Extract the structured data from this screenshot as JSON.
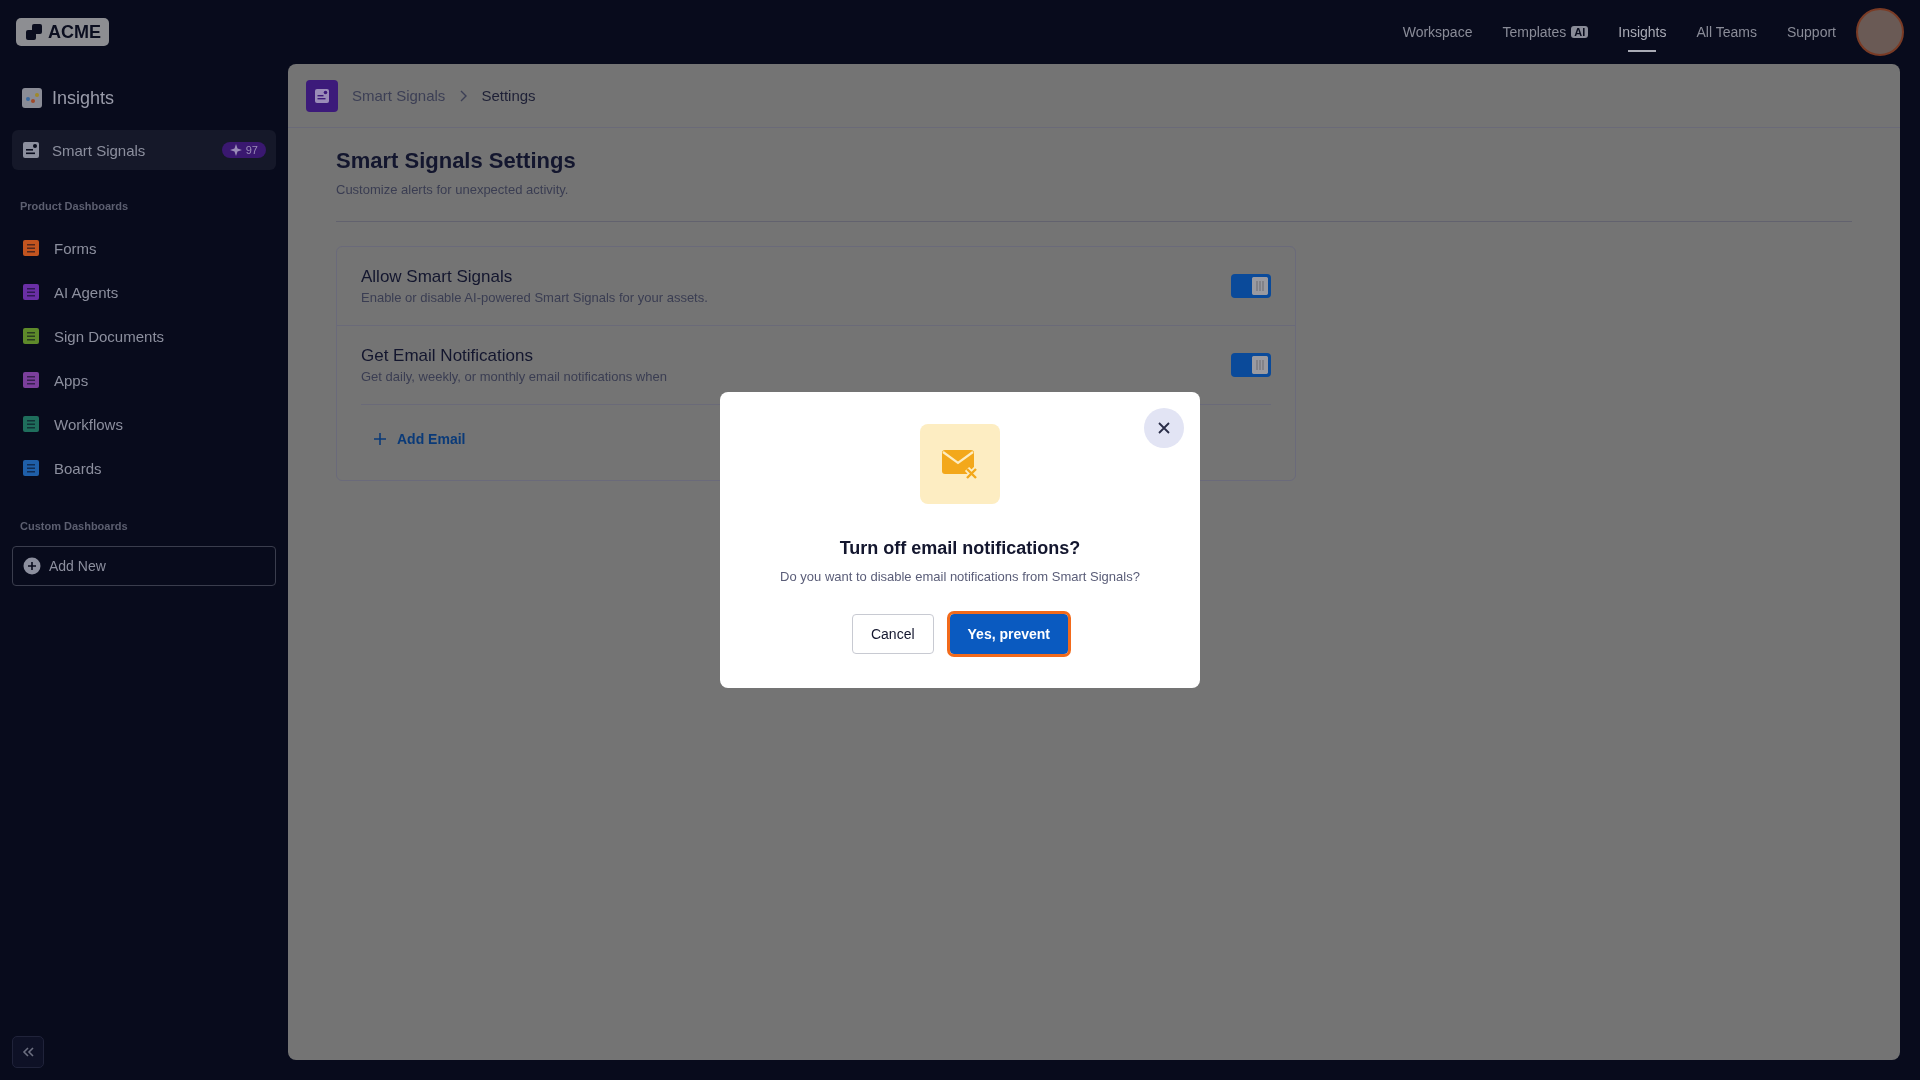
{
  "topbar": {
    "logo": "ACME",
    "nav": [
      {
        "label": "Workspace",
        "selected": false
      },
      {
        "label": "Templates",
        "badge": "AI",
        "selected": false
      },
      {
        "label": "Insights",
        "selected": true
      },
      {
        "label": "All Teams",
        "selected": false
      },
      {
        "label": "Support",
        "selected": false
      }
    ]
  },
  "sidebar": {
    "title": "Insights",
    "main_item": {
      "label": "Smart Signals",
      "badge": "97",
      "selected": true
    },
    "sections": [
      {
        "heading": "Product Dashboards",
        "items": [
          {
            "label": "Forms",
            "color": "#c2541f"
          },
          {
            "label": "AI Agents",
            "color": "#6a2fa6"
          },
          {
            "label": "Sign Documents",
            "color": "#5e8a2a"
          },
          {
            "label": "Apps",
            "color": "#7b3f9c"
          },
          {
            "label": "Workflows",
            "color": "#1f6e5c"
          },
          {
            "label": "Boards",
            "color": "#1f5fa8"
          }
        ]
      },
      {
        "heading": "Custom Dashboards",
        "add_button": "Add New"
      }
    ]
  },
  "breadcrumb": [
    {
      "label": "Smart Signals",
      "selected": false
    },
    {
      "label": "Settings",
      "selected": true
    }
  ],
  "page": {
    "title": "Smart Signals Settings",
    "subtitle": "Customize alerts for unexpected activity.",
    "settings": [
      {
        "title": "Allow Smart Signals",
        "description": "Enable or disable AI-powered Smart Signals for your assets.",
        "on": true
      },
      {
        "title": "Get Email Notifications",
        "description": "Get daily, weekly, or monthly email notifications when",
        "on": true
      }
    ],
    "add_email": "Add Email"
  },
  "modal": {
    "title": "Turn off email notifications?",
    "message": "Do you want to disable email notifications from Smart Signals?",
    "buttons": [
      {
        "label": "Cancel",
        "kind": "secondary",
        "focused": false
      },
      {
        "label": "Yes, prevent",
        "kind": "primary",
        "focused": true
      }
    ]
  }
}
